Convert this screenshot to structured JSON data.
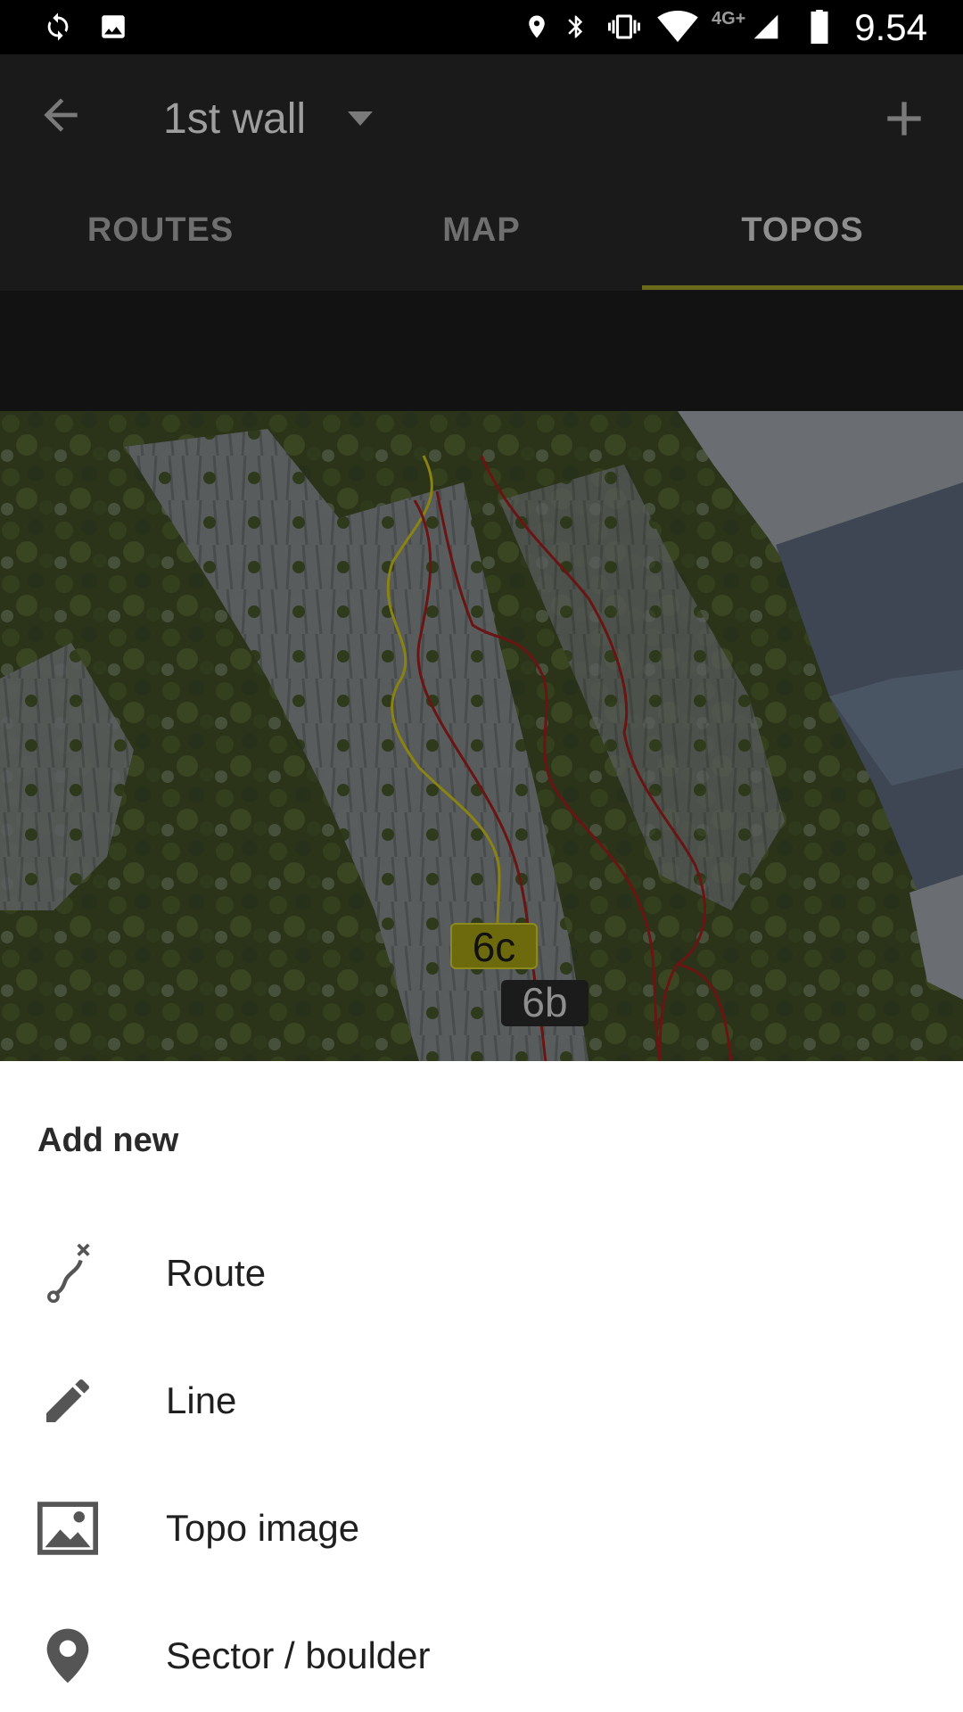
{
  "status_bar": {
    "network_label": "4G+",
    "time": "9.54",
    "icons": [
      "sync-icon",
      "image-icon",
      "location-icon",
      "bluetooth-icon",
      "vibrate-icon",
      "wifi-icon",
      "signal-icon",
      "battery-icon"
    ]
  },
  "app_bar": {
    "back_icon": "arrow-back-icon",
    "title": "1st wall",
    "dropdown_icon": "dropdown-arrow-icon",
    "add_icon": "plus-icon"
  },
  "tabs": [
    {
      "label": "ROUTES",
      "active": false
    },
    {
      "label": "MAP",
      "active": false
    },
    {
      "label": "TOPOS",
      "active": true
    }
  ],
  "topo": {
    "grades": [
      {
        "label": "6c",
        "color": "#6d6a0d"
      },
      {
        "label": "6b",
        "color": "#1b1b1b"
      }
    ],
    "line_colors": {
      "yellow": "#8a8312",
      "red": "#6b1414"
    }
  },
  "sheet": {
    "title": "Add new",
    "items": [
      {
        "label": "Route",
        "icon": "route-icon"
      },
      {
        "label": "Line",
        "icon": "pencil-icon"
      },
      {
        "label": "Topo image",
        "icon": "image-icon"
      },
      {
        "label": "Sector / boulder",
        "icon": "location-pin-icon"
      }
    ]
  },
  "colors": {
    "accent": "#6b6a1c",
    "appbar": "#1a1a1a",
    "sheet": "#ffffff"
  }
}
